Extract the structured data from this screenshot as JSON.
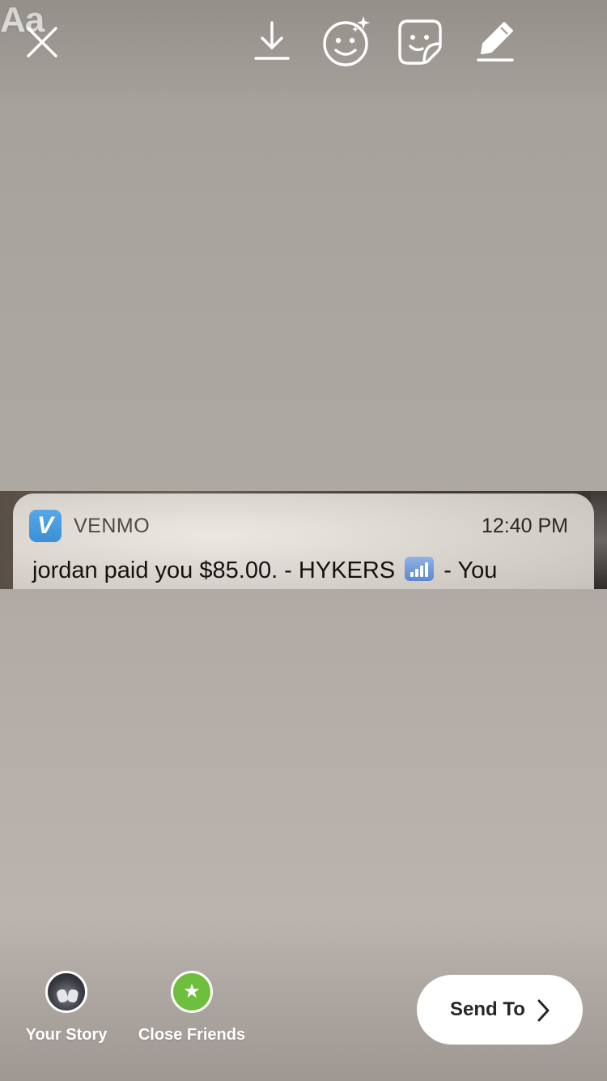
{
  "toolbar": {
    "close_icon": "close-icon",
    "download_icon": "download-icon",
    "face_effects_icon": "face-effects-icon",
    "sticker_icon": "sticker-icon",
    "draw_icon": "draw-icon",
    "text_tool_label": "Aa"
  },
  "notification": {
    "app_icon": "venmo-logo-icon",
    "app_icon_letter": "V",
    "app_name": "VENMO",
    "time": "12:40 PM",
    "body_before": "jordan paid you $85.00. - HYKERS",
    "body_emoji": "signal-bars-emoji",
    "body_after": "- You",
    "colors": {
      "venmo_blue": "#3c8fd6"
    }
  },
  "share": {
    "your_story_label": "Your Story",
    "close_friends_label": "Close Friends",
    "close_friends_icon": "star-icon",
    "colors": {
      "close_friends_green": "#6ebf3e"
    }
  },
  "send": {
    "label": "Send To",
    "icon": "chevron-right-icon"
  }
}
